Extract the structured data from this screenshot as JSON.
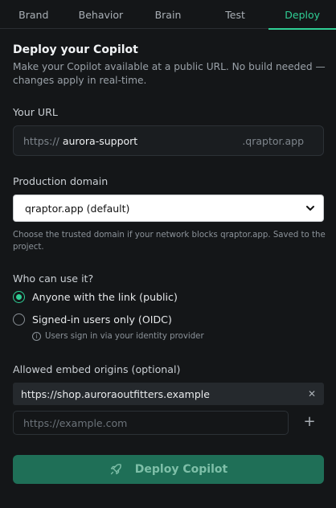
{
  "tabs": [
    {
      "label": "Brand"
    },
    {
      "label": "Behavior"
    },
    {
      "label": "Brain"
    },
    {
      "label": "Test"
    },
    {
      "label": "Deploy"
    }
  ],
  "active_tab": "Deploy",
  "header": {
    "title": "Deploy your Copilot",
    "description": "Make your Copilot available at a public URL. No build needed — changes apply in real-time."
  },
  "url": {
    "label": "Your URL",
    "prefix": "https://",
    "value": "aurora-support",
    "suffix": ".qraptor.app"
  },
  "domain": {
    "label": "Production domain",
    "selected": "qraptor.app (default)",
    "hint": "Choose the trusted domain if your network blocks qraptor.app. Saved to the project."
  },
  "access": {
    "label": "Who can use it?",
    "options": [
      {
        "label": "Anyone with the link (public)",
        "checked": true
      },
      {
        "label": "Signed-in users only (OIDC)",
        "checked": false
      }
    ],
    "oidc_hint": "Users sign in via your identity provider"
  },
  "embed": {
    "label": "Allowed embed origins (optional)",
    "origins": [
      "https://shop.auroraoutfitters.example"
    ],
    "input_placeholder": "https://example.com"
  },
  "deploy_button": {
    "label": "Deploy Copilot"
  },
  "colors": {
    "accent": "#2fcf95",
    "background": "#141618",
    "button": "#1f6f57"
  }
}
